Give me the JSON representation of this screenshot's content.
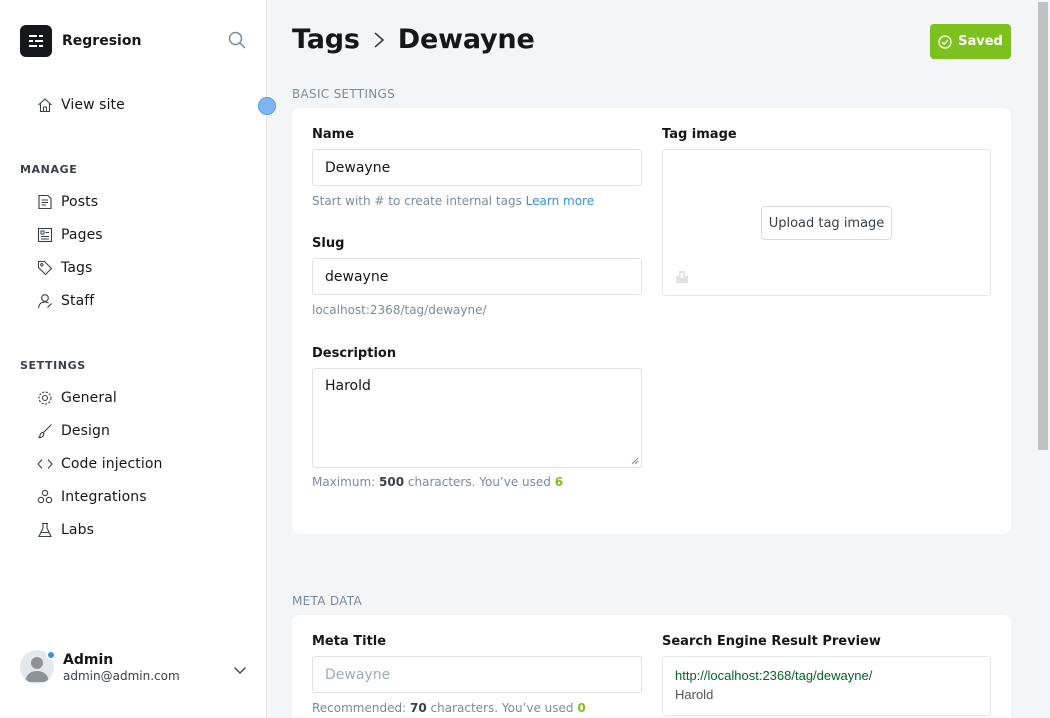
{
  "sidebar": {
    "brand_name": "Regresion",
    "view_site": "View site",
    "manage_label": "MANAGE",
    "manage_items": [
      {
        "label": "Posts",
        "icon": "posts-icon"
      },
      {
        "label": "Pages",
        "icon": "pages-icon"
      },
      {
        "label": "Tags",
        "icon": "tag-icon"
      },
      {
        "label": "Staff",
        "icon": "staff-icon"
      }
    ],
    "settings_label": "SETTINGS",
    "settings_items": [
      {
        "label": "General",
        "icon": "gear-icon"
      },
      {
        "label": "Design",
        "icon": "brush-icon"
      },
      {
        "label": "Code injection",
        "icon": "code-icon"
      },
      {
        "label": "Integrations",
        "icon": "integrations-icon"
      },
      {
        "label": "Labs",
        "icon": "flask-icon"
      }
    ],
    "user": {
      "name": "Admin",
      "email": "admin@admin.com"
    }
  },
  "header": {
    "breadcrumb_parent": "Tags",
    "breadcrumb_current": "Dewayne",
    "saved_label": "Saved"
  },
  "basic": {
    "section_label": "BASIC SETTINGS",
    "name_label": "Name",
    "name_value": "Dewayne",
    "name_hint": "Start with # to create internal tags",
    "learn_more": "Learn more",
    "slug_label": "Slug",
    "slug_value": "dewayne",
    "slug_url": "localhost:2368/tag/dewayne/",
    "description_label": "Description",
    "description_value": "Harold",
    "desc_hint_prefix": "Maximum:",
    "desc_max": "500",
    "desc_hint_mid": "characters. You’ve used",
    "desc_used": "6",
    "tag_image_label": "Tag image",
    "upload_label": "Upload tag image"
  },
  "meta": {
    "section_label": "META DATA",
    "meta_title_label": "Meta Title",
    "meta_title_placeholder": "Dewayne",
    "meta_hint_prefix": "Recommended:",
    "meta_max": "70",
    "meta_hint_mid": "characters. You’ve used",
    "meta_used": "0",
    "serp_label": "Search Engine Result Preview",
    "serp_url": "http://localhost:2368/tag/dewayne/",
    "serp_desc": "Harold"
  },
  "colors": {
    "accent_green": "#7dc11f",
    "link_blue": "#3a8ee6"
  }
}
